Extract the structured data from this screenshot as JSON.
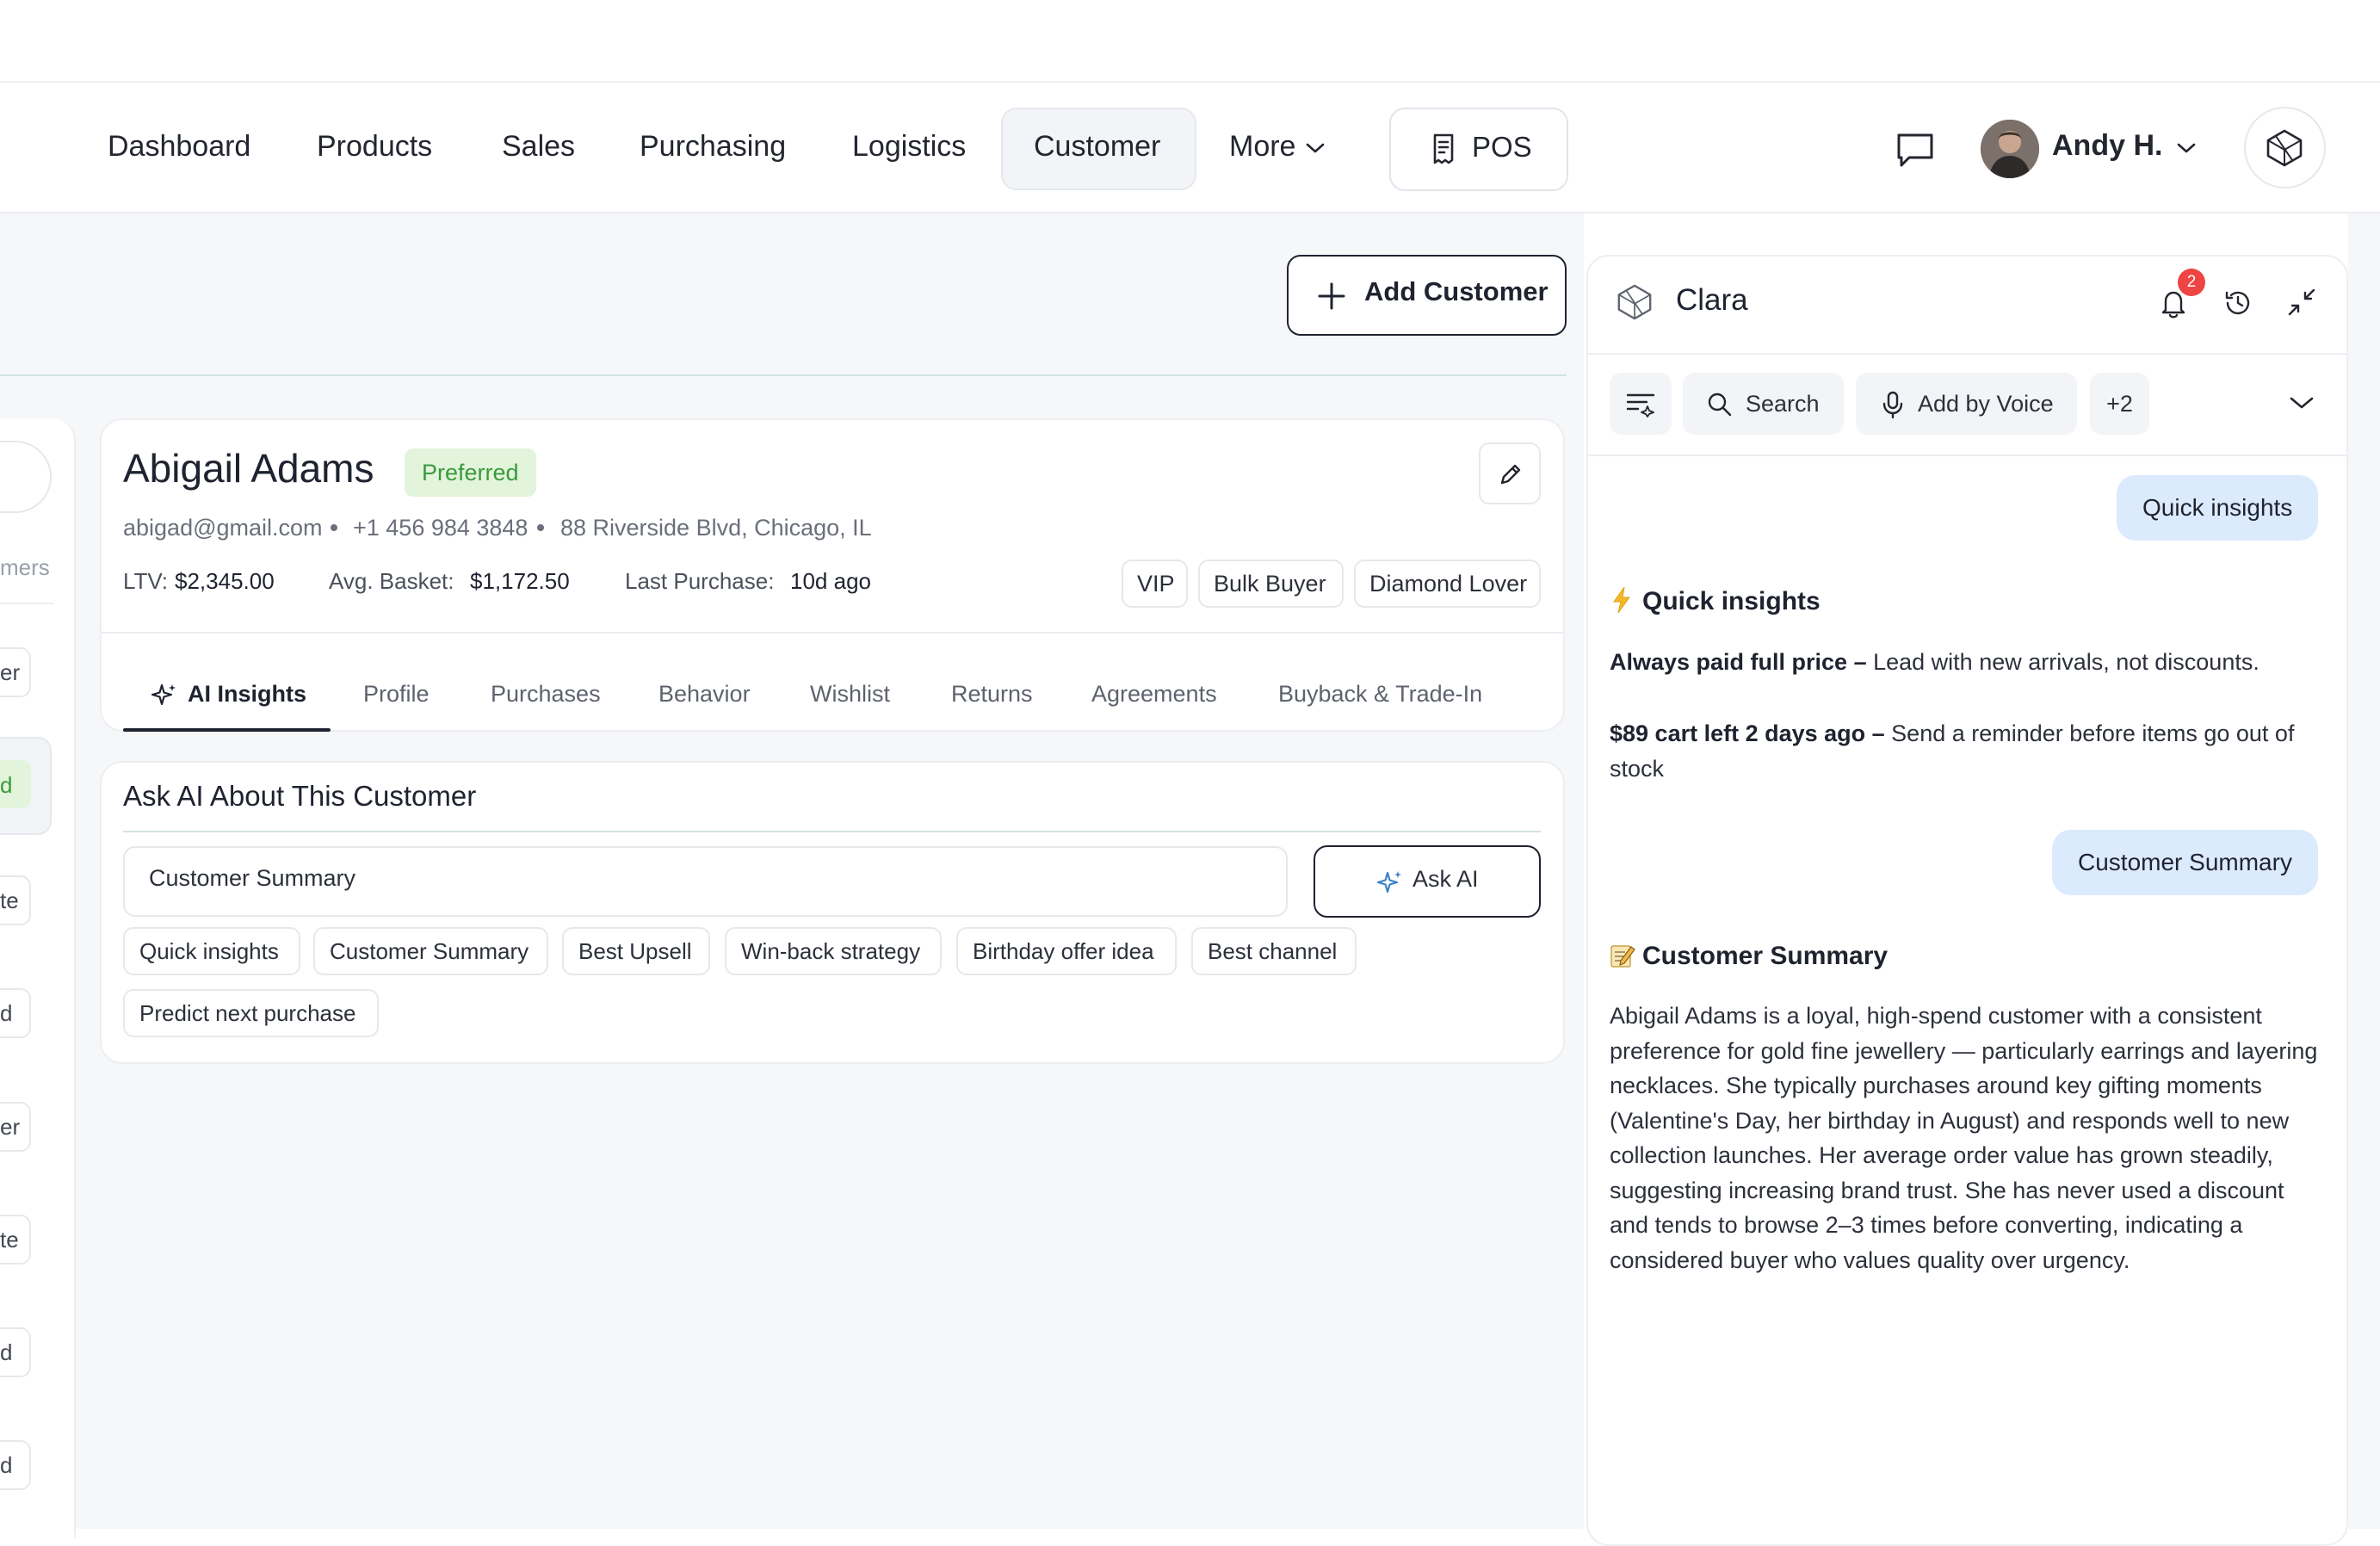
{
  "nav": {
    "items": [
      "Dashboard",
      "Products",
      "Sales",
      "Purchasing",
      "Logistics",
      "Customer",
      "More"
    ],
    "active": "Customer",
    "pos_label": "POS",
    "user_name": "Andy H."
  },
  "toolbar": {
    "add_customer_label": "Add Customer"
  },
  "left_list": {
    "peek_texts": [
      "mers",
      "er",
      "d",
      "te",
      "d",
      "er",
      "te",
      "d",
      "d"
    ]
  },
  "customer": {
    "name": "Abigail Adams",
    "status_badge": "Preferred",
    "email": "abigad@gmail.com",
    "phone": "+1 456 984 3848",
    "address": "88 Riverside Blvd, Chicago, IL",
    "ltv_label": "LTV:",
    "ltv_value": "$2,345.00",
    "avg_basket_label": "Avg. Basket:",
    "avg_basket_value": "$1,172.50",
    "last_purchase_label": "Last Purchase:",
    "last_purchase_value": "10d ago",
    "tags": [
      "VIP",
      "Bulk Buyer",
      "Diamond Lover"
    ],
    "tabs": [
      "AI Insights",
      "Profile",
      "Purchases",
      "Behavior",
      "Wishlist",
      "Returns",
      "Agreements",
      "Buyback & Trade-In"
    ],
    "active_tab": "AI Insights"
  },
  "ask_ai": {
    "title": "Ask AI About This Customer",
    "input_value": "Customer Summary",
    "button_label": "Ask AI",
    "chips": [
      "Quick insights",
      "Customer Summary",
      "Best Upsell",
      "Win-back strategy",
      "Birthday offer idea",
      "Best channel",
      "Predict next purchase"
    ]
  },
  "clara": {
    "title": "Clara",
    "notification_count": "2",
    "tools": {
      "search": "Search",
      "voice": "Add by Voice",
      "more": "+2"
    },
    "messages": {
      "user1": "Quick insights",
      "insights_heading": "Quick insights",
      "insight1_bold": "Always paid full price –",
      "insight1_text": " Lead with new arrivals, not discounts.",
      "insight2_bold": "$89 cart left 2 days ago –",
      "insight2_text": " Send a reminder before items go out of stock",
      "user2": "Customer Summary",
      "summary_heading": "Customer Summary",
      "summary_text": "Abigail Adams is a loyal, high-spend customer with a consistent preference for gold fine jewellery — particularly earrings and layering necklaces. She typically purchases around key gifting moments (Valentine's Day, her birthday in August) and responds well to new collection launches. Her average order value has grown steadily, suggesting increasing brand trust. She has never used a discount and tends to browse 2–3 times before converting, indicating a considered buyer who values quality over urgency."
    }
  },
  "colors": {
    "accent_blue_bubble": "#dbeafd",
    "preferred_green": "#3b9a3b",
    "badge_red": "#ef4444",
    "teal_divider": "#cfe3e1"
  },
  "icons": [
    "chevron-down-icon",
    "pos-receipt-icon",
    "chat-bubble-icon",
    "logo-cube-icon",
    "plus-icon",
    "pencil-icon",
    "sparkle-icon",
    "bell-icon",
    "history-icon",
    "collapse-icon",
    "filter-list-icon",
    "search-icon",
    "microphone-icon",
    "lightning-icon",
    "memo-icon"
  ]
}
